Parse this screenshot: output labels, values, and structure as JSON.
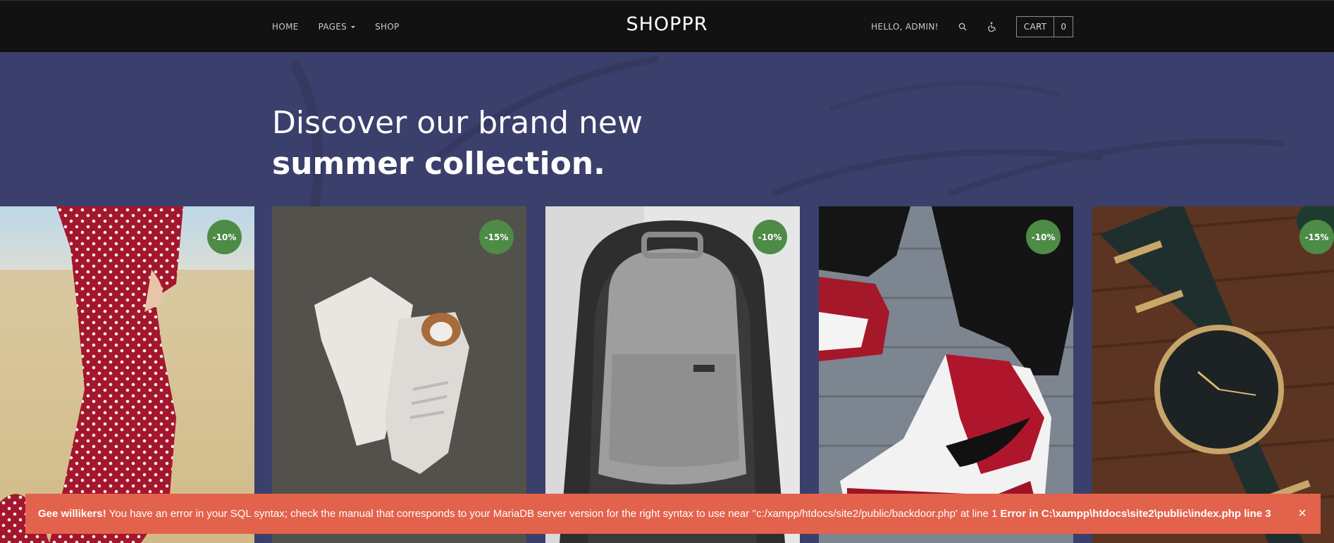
{
  "nav": {
    "links": [
      {
        "label": "HOME"
      },
      {
        "label": "PAGES"
      },
      {
        "label": "SHOP"
      }
    ],
    "brand": "SHOPPR",
    "greeting": "HELLO, ADMIN!",
    "cart_label": "CART",
    "cart_count": "0"
  },
  "hero": {
    "line1": "Discover our brand new",
    "line2": "summer collection."
  },
  "products": [
    {
      "name": "polka-dot-dress",
      "discount": "-10%"
    },
    {
      "name": "white-sneakers",
      "discount": "-15%"
    },
    {
      "name": "grey-backpack",
      "discount": "-10%"
    },
    {
      "name": "red-sneakers",
      "discount": "-10%"
    },
    {
      "name": "watch",
      "discount": "-15%"
    }
  ],
  "alert": {
    "title": "Gee willikers!",
    "message": "You have an error in your SQL syntax; check the manual that corresponds to your MariaDB server version for the right syntax to use near ''c:/xampp/htdocs/site2/public/backdoor.php' at line 1",
    "error_location": "Error in C:\\xampp\\htdocs\\site2\\public\\index.php line 3",
    "close_symbol": "×"
  },
  "colors": {
    "navbar": "#121212",
    "hero": "#3b3f6b",
    "badge": "#4d8b46",
    "alert": "#e3624b"
  }
}
